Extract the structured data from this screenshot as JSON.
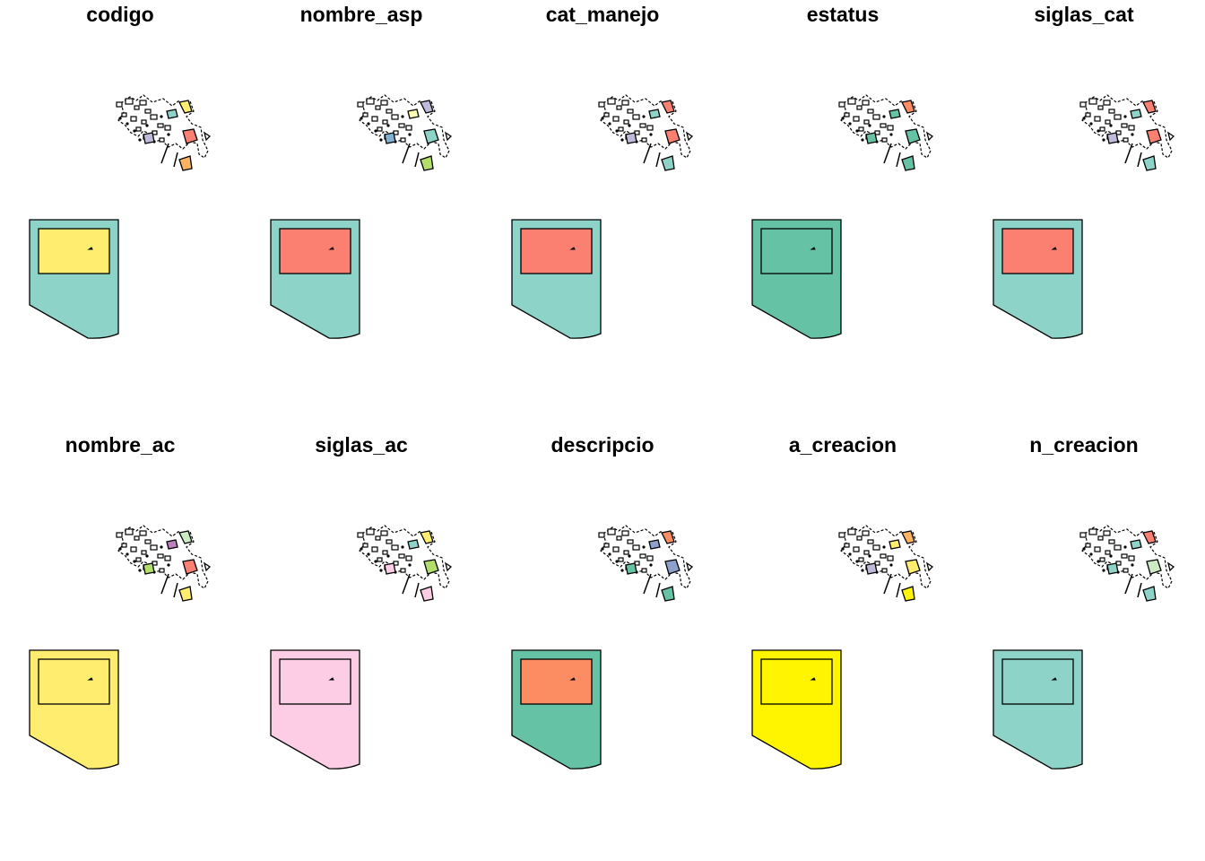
{
  "panels": [
    {
      "title": "codigo",
      "outer_fill": "#8DD3C7",
      "inner_fill": "#FFED6F",
      "islands": [
        "#FFED6F",
        "#8DD3C7",
        "#FB8072",
        "#BEBADA",
        "#FDB462"
      ]
    },
    {
      "title": "nombre_asp",
      "outer_fill": "#8DD3C7",
      "inner_fill": "#FB8072",
      "islands": [
        "#BEBADA",
        "#FFFFB3",
        "#8DD3C7",
        "#80B1D3",
        "#B3DE69"
      ]
    },
    {
      "title": "cat_manejo",
      "outer_fill": "#8DD3C7",
      "inner_fill": "#FB8072",
      "islands": [
        "#FB8072",
        "#8DD3C7",
        "#FB8072",
        "#BEBADA",
        "#8DD3C7"
      ]
    },
    {
      "title": "estatus",
      "outer_fill": "#66C2A5",
      "inner_fill": "#66C2A5",
      "islands": [
        "#FC8D62",
        "#66C2A5",
        "#66C2A5",
        "#66C2A5",
        "#66C2A5"
      ]
    },
    {
      "title": "siglas_cat",
      "outer_fill": "#8DD3C7",
      "inner_fill": "#FB8072",
      "islands": [
        "#FB8072",
        "#8DD3C7",
        "#FB8072",
        "#BEBADA",
        "#8DD3C7"
      ]
    },
    {
      "title": "nombre_ac",
      "outer_fill": "#FFED6F",
      "inner_fill": "#FFED6F",
      "islands": [
        "#CCEBC5",
        "#BC80BD",
        "#FB8072",
        "#B3DE69",
        "#FFED6F"
      ]
    },
    {
      "title": "siglas_ac",
      "outer_fill": "#FCCDE5",
      "inner_fill": "#FCCDE5",
      "islands": [
        "#FFED6F",
        "#8DD3C7",
        "#B3DE69",
        "#FCCDE5",
        "#FCCDE5"
      ]
    },
    {
      "title": "descripcio",
      "outer_fill": "#66C2A5",
      "inner_fill": "#FC8D62",
      "islands": [
        "#FC8D62",
        "#8DA0CB",
        "#8DA0CB",
        "#66C2A5",
        "#66C2A5"
      ]
    },
    {
      "title": "a_creacion",
      "outer_fill": "#FFF500",
      "inner_fill": "#FFF500",
      "islands": [
        "#FDB462",
        "#FFED6F",
        "#FFED6F",
        "#BEBADA",
        "#FFF500"
      ]
    },
    {
      "title": "n_creacion",
      "outer_fill": "#8DD3C7",
      "inner_fill": "#8DD3C7",
      "islands": [
        "#FB8072",
        "#8DD3C7",
        "#CCEBC5",
        "#8DD3C7",
        "#8DD3C7"
      ]
    }
  ]
}
